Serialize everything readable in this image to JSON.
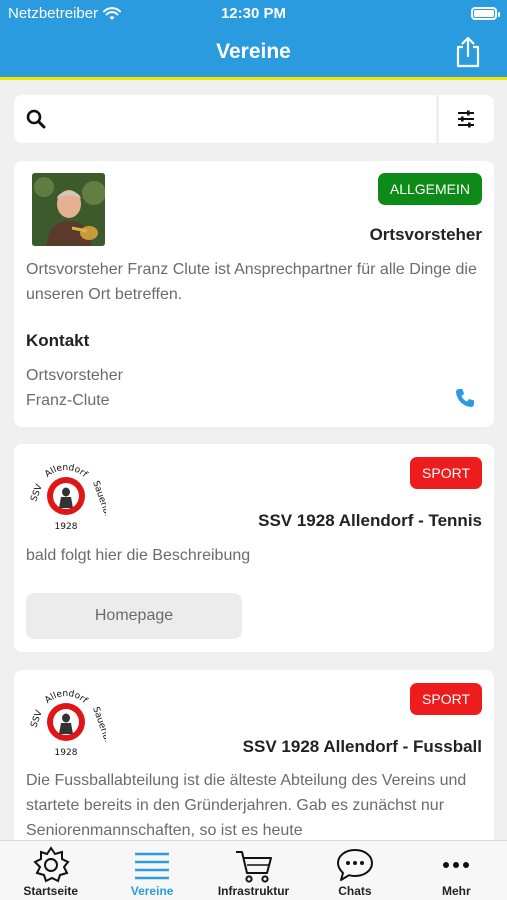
{
  "status": {
    "carrier": "Netzbetreiber",
    "time": "12:30 PM"
  },
  "nav": {
    "title": "Vereine"
  },
  "search": {
    "value": "",
    "placeholder": ""
  },
  "cards": [
    {
      "badge": "ALLGEMEIN",
      "badge_color": "#0d8a17",
      "title": "Ortsvorsteher",
      "description": "Ortsvorsteher Franz Clute ist Ansprechpartner für alle Dinge die unseren Ort betreffen.",
      "contact_heading": "Kontakt",
      "contact_role": "Ortsvorsteher",
      "contact_name": "Franz-Clute"
    },
    {
      "badge": "SPORT",
      "badge_color": "#ee1c1c",
      "title": "SSV 1928 Allendorf - Tennis",
      "description": "bald folgt hier die Beschreibung",
      "button": "Homepage",
      "logo": {
        "top": "Allendorf",
        "left": "SSV",
        "right": "Sauerland",
        "bottom": "1928"
      }
    },
    {
      "badge": "SPORT",
      "badge_color": "#ee1c1c",
      "title": "SSV 1928 Allendorf - Fussball",
      "description": "Die Fussballabteilung ist die älteste Abteilung des Vereins und startete bereits in den Gründerjahren. Gab es zunächst nur Seniorenmannschaften, so ist es heute",
      "logo": {
        "top": "Allendorf",
        "left": "SSV",
        "right": "Sauerland",
        "bottom": "1928"
      }
    }
  ],
  "tabs": [
    {
      "label": "Startseite",
      "icon": "gear-icon"
    },
    {
      "label": "Vereine",
      "icon": "list-icon"
    },
    {
      "label": "Infrastruktur",
      "icon": "cart-icon"
    },
    {
      "label": "Chats",
      "icon": "chat-icon"
    },
    {
      "label": "Mehr",
      "icon": "more-icon"
    }
  ],
  "colors": {
    "accent": "#2b9be0",
    "accent_line": "#f2e600"
  }
}
